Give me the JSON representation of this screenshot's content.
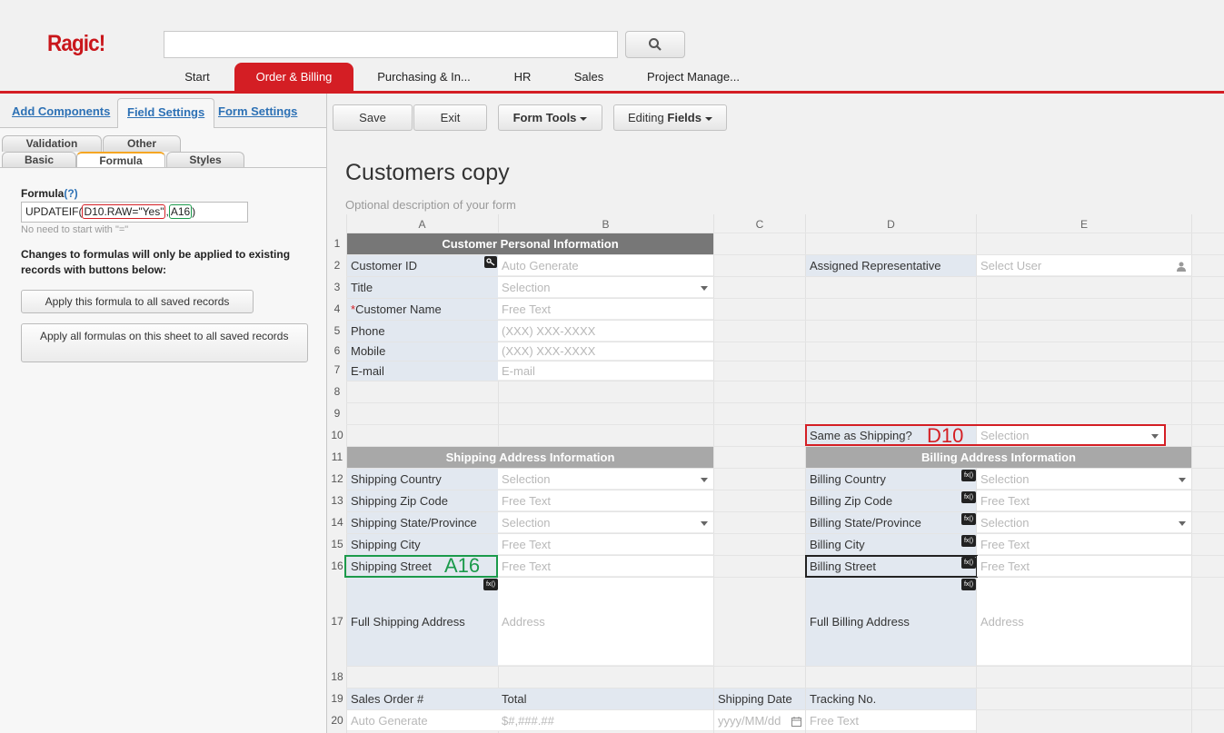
{
  "app": {
    "logo": "Ragic!"
  },
  "search": {
    "placeholder": ""
  },
  "nav": {
    "tabs": [
      "Start",
      "Order & Billing",
      "Purchasing & In...",
      "HR",
      "Sales",
      "Project Manage..."
    ],
    "active": "Order & Billing"
  },
  "left_panel": {
    "top_tabs": [
      "Add Components",
      "Field Settings",
      "Form Settings"
    ],
    "active_top_tab": "Field Settings",
    "sub_tabs_row1": [
      "Validation",
      "Other"
    ],
    "sub_tabs_row2": [
      "Basic",
      "Formula",
      "Styles"
    ],
    "active_sub_tab": "Formula",
    "formula_label": "Formula",
    "formula_help": "(?)",
    "formula_prefix": "UPDATEIF(",
    "formula_part1": "D10.RAW=\"Yes\"",
    "formula_comma": ",",
    "formula_part2": "A16",
    "formula_suffix": ")",
    "formula_hint": "No need to start with \"=\"",
    "changes_note": "Changes to formulas will only be applied to existing records with buttons below:",
    "apply_btn1": "Apply this formula to all saved records",
    "apply_btn2": "Apply all formulas on this sheet to all saved records"
  },
  "toolbar": {
    "save": "Save",
    "exit": "Exit",
    "form_tools": "Form Tools",
    "editing_prefix": "Editing",
    "editing_bold": "Fields"
  },
  "sheet": {
    "title": "Customers copy",
    "description": "Optional description of your form",
    "columns": [
      "A",
      "B",
      "C",
      "D",
      "E"
    ],
    "rows": [
      "1",
      "2",
      "3",
      "4",
      "5",
      "6",
      "7",
      "8",
      "9",
      "10",
      "11",
      "12",
      "13",
      "14",
      "15",
      "16",
      "17",
      "18",
      "19",
      "20"
    ],
    "sections": {
      "customer": "Customer Personal Information",
      "shipping": "Shipping Address Information",
      "billing": "Billing Address Information"
    },
    "fields": {
      "customer_id": "Customer ID",
      "customer_id_ph": "Auto Generate",
      "title": "Title",
      "title_ph": "Selection",
      "req_mark": "*",
      "customer_name": "Customer Name",
      "customer_name_ph": "Free Text",
      "phone": "Phone",
      "phone_ph": "(XXX) XXX-XXXX",
      "mobile": "Mobile",
      "mobile_ph": "(XXX) XXX-XXXX",
      "email": "E-mail",
      "email_ph": "E-mail",
      "assigned_rep": "Assigned Representative",
      "assigned_rep_ph": "Select User",
      "same_as_shipping": "Same as Shipping?",
      "same_as_shipping_ph": "Selection",
      "ship_country": "Shipping Country",
      "ship_country_ph": "Selection",
      "ship_zip": "Shipping Zip Code",
      "ship_zip_ph": "Free Text",
      "ship_state": "Shipping State/Province",
      "ship_state_ph": "Selection",
      "ship_city": "Shipping City",
      "ship_city_ph": "Free Text",
      "ship_street": "Shipping Street",
      "ship_street_ph": "Free Text",
      "full_ship": "Full Shipping Address",
      "full_ship_ph": "Address",
      "bill_country": "Billing Country",
      "bill_country_ph": "Selection",
      "bill_zip": "Billing Zip Code",
      "bill_zip_ph": "Free Text",
      "bill_state": "Billing State/Province",
      "bill_state_ph": "Selection",
      "bill_city": "Billing City",
      "bill_city_ph": "Free Text",
      "bill_street": "Billing Street",
      "bill_street_ph": "Free Text",
      "full_bill": "Full Billing Address",
      "full_bill_ph": "Address",
      "sales_order": "Sales Order #",
      "sales_order_ph": "Auto Generate",
      "total": "Total",
      "total_ph": "$#,###.##",
      "ship_date": "Shipping Date",
      "ship_date_ph": "yyyy/MM/dd",
      "tracking": "Tracking No.",
      "tracking_ph": "Free Text"
    },
    "annotations": {
      "d10": "D10",
      "a16": "A16"
    },
    "fx_label": "fx()"
  },
  "colors": {
    "brand_red": "#d41e24",
    "header_dark": "#777777",
    "header_mid": "#a8a8a8",
    "label_bg": "#e2e8f0",
    "annot_red": "#d41e24",
    "annot_green": "#1b9a4b"
  },
  "icons": [
    "search-icon",
    "key-icon",
    "user-icon",
    "calendar-icon",
    "chevron-down-icon",
    "fx-icon"
  ]
}
